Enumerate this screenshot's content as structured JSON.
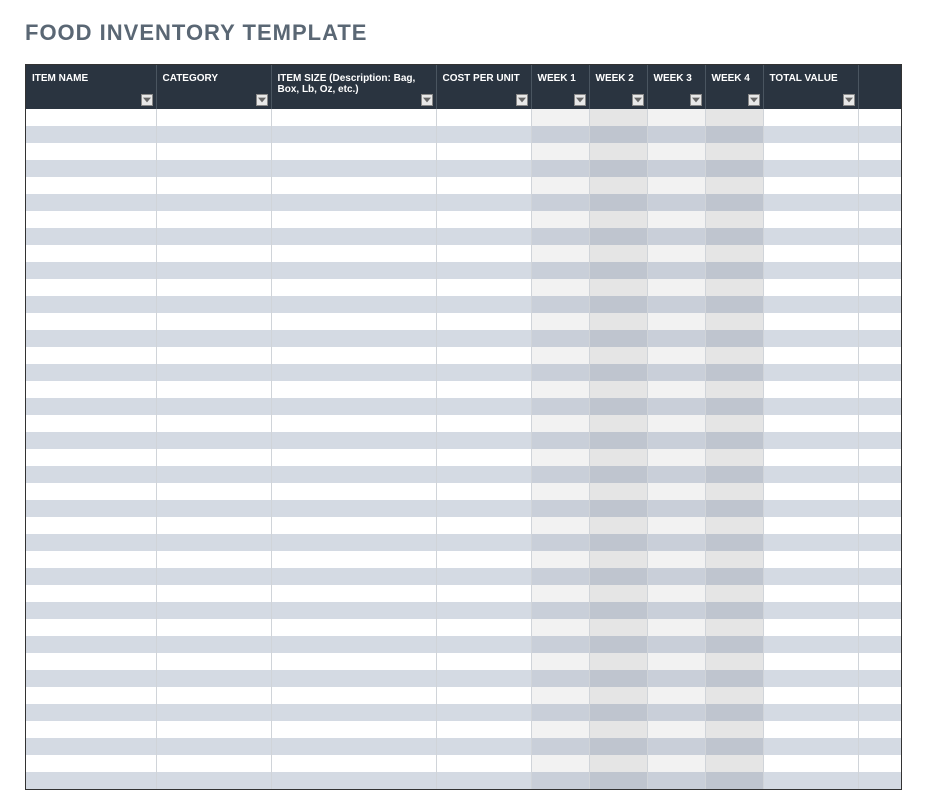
{
  "title": "FOOD INVENTORY  TEMPLATE",
  "columns": {
    "item_name": "ITEM NAME",
    "category": "CATEGORY",
    "item_size": "ITEM SIZE (Description: Bag, Box, Lb, Oz, etc.)",
    "cost_per_unit": "COST PER UNIT",
    "week1": "WEEK 1",
    "week2": "WEEK 2",
    "week3": "WEEK 3",
    "week4": "WEEK 4",
    "total_value": "TOTAL VALUE"
  },
  "row_count": 40,
  "colors": {
    "title": "#5a6774",
    "header_bg": "#2a3440",
    "header_text": "#ffffff",
    "row_even": "#d4dae3",
    "row_odd": "#ffffff"
  }
}
